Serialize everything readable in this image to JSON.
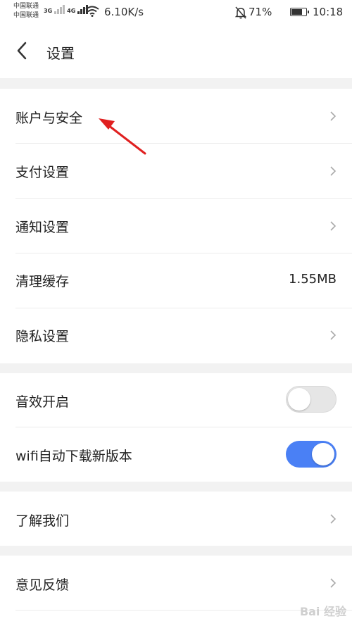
{
  "statusbar": {
    "carrier1": "中国联通",
    "carrier2": "中国联通",
    "net1": "3G",
    "net2": "4G",
    "speed": "6.10K/s",
    "battery": "71%",
    "time": "10:18"
  },
  "header": {
    "title": "设置",
    "back_icon": "chevron-left-icon"
  },
  "settings": {
    "account_security": "账户与安全",
    "payment": "支付设置",
    "notification": "通知设置",
    "clear_cache": "清理缓存",
    "cache_size": "1.55MB",
    "privacy": "隐私设置",
    "sound": "音效开启",
    "sound_enabled": false,
    "wifi_download": "wifi自动下载新版本",
    "wifi_download_enabled": true,
    "about": "了解我们",
    "feedback": "意见反馈"
  },
  "colors": {
    "toggle_on": "#4a80f5",
    "toggle_off": "#e6e6e6",
    "annotation_arrow": "#e02020",
    "section_gap": "#f2f2f2"
  },
  "watermark": "Bai 经验"
}
